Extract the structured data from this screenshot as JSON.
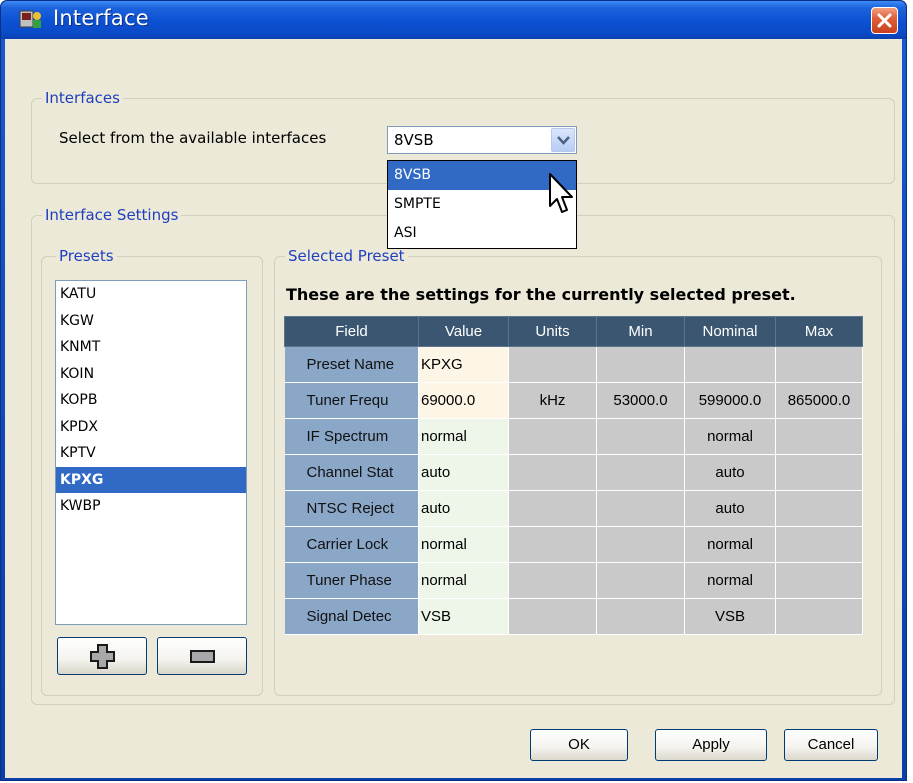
{
  "window": {
    "title": "Interface"
  },
  "interfaces": {
    "group_label": "Interfaces",
    "select_label": "Select from the available interfaces",
    "selected": "8VSB",
    "options": [
      "8VSB",
      "SMPTE",
      "ASI"
    ]
  },
  "settings": {
    "group_label": "Interface Settings",
    "presets_label": "Presets",
    "presets": [
      "KATU",
      "KGW",
      "KNMT",
      "KOIN",
      "KOPB",
      "KPDX",
      "KPTV",
      "KPXG",
      "KWBP"
    ],
    "selected_preset": "KPXG",
    "selected_preset_label": "Selected Preset",
    "caption": "These are the settings for the currently selected preset.",
    "columns": [
      "Field",
      "Value",
      "Units",
      "Min",
      "Nominal",
      "Max"
    ],
    "rows": [
      [
        "Preset Name",
        "KPXG",
        "",
        "",
        "",
        ""
      ],
      [
        "Tuner Frequ",
        "69000.0",
        "kHz",
        "53000.0",
        "599000.0",
        "865000.0"
      ],
      [
        "IF Spectrum",
        "normal",
        "",
        "",
        "normal",
        ""
      ],
      [
        "Channel Stat",
        "auto",
        "",
        "",
        "auto",
        ""
      ],
      [
        "NTSC Reject",
        "auto",
        "",
        "",
        "auto",
        ""
      ],
      [
        "Carrier Lock",
        "normal",
        "",
        "",
        "normal",
        ""
      ],
      [
        "Tuner Phase",
        "normal",
        "",
        "",
        "normal",
        ""
      ],
      [
        "Signal Detec",
        "VSB",
        "",
        "",
        "VSB",
        ""
      ]
    ]
  },
  "buttons": {
    "ok": "OK",
    "apply": "Apply",
    "cancel": "Cancel"
  },
  "colors": {
    "title_bar": "#0a4ac8",
    "selection": "#316ac5",
    "group_label": "#1f3fbf",
    "grid_header": "#3b5670",
    "field_cell": "#8aa7c8"
  },
  "icons": {
    "app": "interface-app-icon",
    "close": "close-icon",
    "dropdown": "chevron-down-icon",
    "add": "plus-icon",
    "remove": "minus-icon",
    "cursor": "mouse-pointer-icon"
  }
}
